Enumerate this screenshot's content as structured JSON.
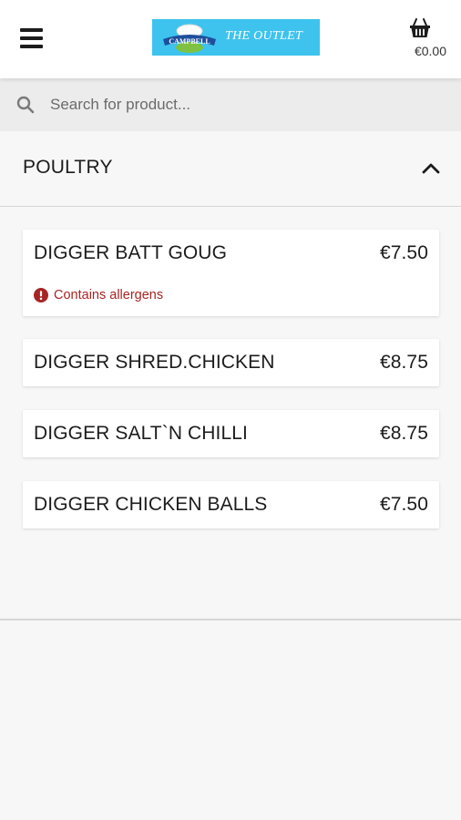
{
  "header": {
    "logo_badge_text": "CAMPBELL",
    "logo_text": "THE OUTLET",
    "cart_total": "€0.00",
    "brand_color": "#3ec3ee"
  },
  "search": {
    "placeholder": "Search for product..."
  },
  "category": {
    "title": "POULTRY",
    "expanded": true
  },
  "products": [
    {
      "name": "DIGGER BATT GOUG",
      "price": "€7.50",
      "allergen_note": "Contains allergens"
    },
    {
      "name": "DIGGER SHRED.CHICKEN",
      "price": "€8.75"
    },
    {
      "name": "DIGGER SALT`N CHILLI",
      "price": "€8.75"
    },
    {
      "name": "DIGGER CHICKEN BALLS",
      "price": "€7.50"
    }
  ],
  "colors": {
    "allergen": "#a82424",
    "background": "#f7f7f7"
  },
  "icons": {
    "menu": "hamburger-menu-icon",
    "cart": "basket-icon",
    "search": "search-icon",
    "collapse": "chevron-up-icon",
    "allergen": "exclamation-circle-icon"
  }
}
